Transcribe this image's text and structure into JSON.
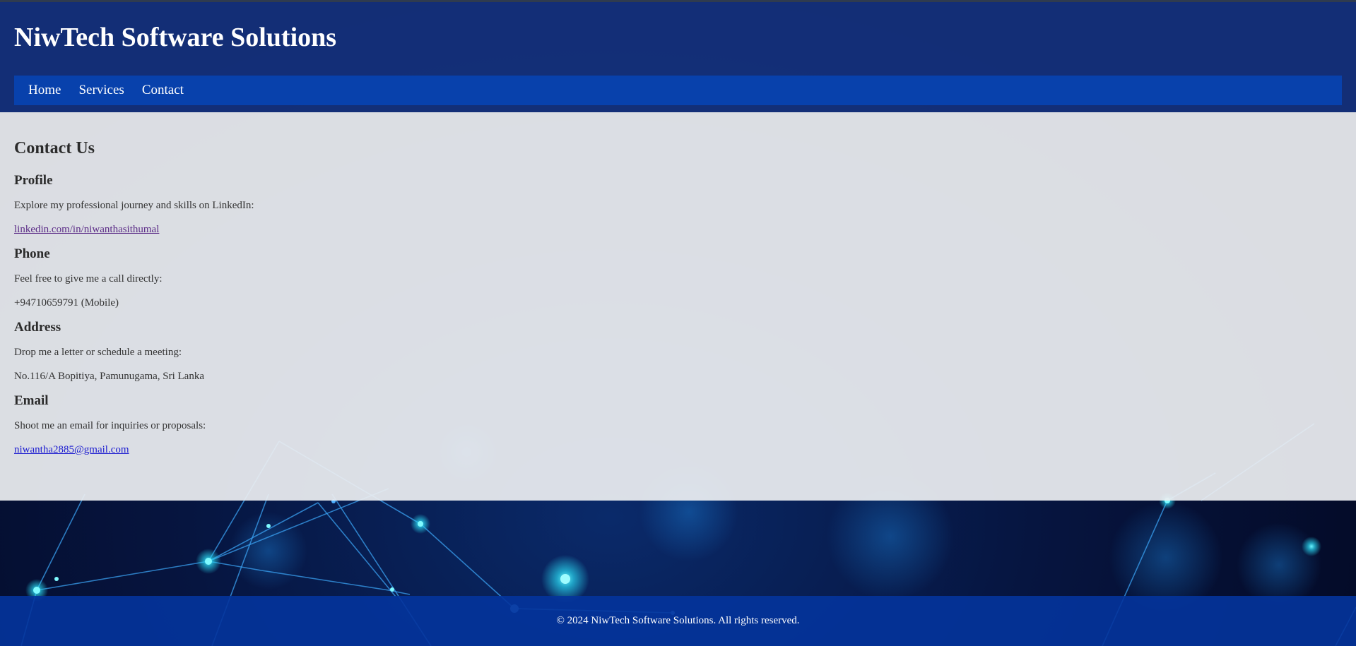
{
  "header": {
    "title": "NiwTech Software Solutions"
  },
  "nav": {
    "items": [
      "Home",
      "Services",
      "Contact"
    ]
  },
  "contact": {
    "heading": "Contact Us",
    "profile": {
      "title": "Profile",
      "text": "Explore my professional journey and skills on LinkedIn:",
      "link": "linkedin.com/in/niwanthasithumal"
    },
    "phone": {
      "title": "Phone",
      "text": "Feel free to give me a call directly:",
      "number": "+94710659791 (Mobile)"
    },
    "address": {
      "title": "Address",
      "text": "Drop me a letter or schedule a meeting:",
      "value": "No.116/A Bopitiya, Pamunugama, Sri Lanka"
    },
    "email": {
      "title": "Email",
      "text": "Shoot me an email for inquiries or proposals:",
      "address": "niwantha2885@gmail.com"
    }
  },
  "footer": {
    "copyright": "© 2024 NiwTech Software Solutions. All rights reserved."
  },
  "colors": {
    "header_bg": "#14327d",
    "nav_bg": "#0841ac",
    "content_bg": "#eceef1",
    "footer_bg": "#04349c",
    "profile_link": "#5a2a86",
    "email_link": "#1a1ad0"
  }
}
